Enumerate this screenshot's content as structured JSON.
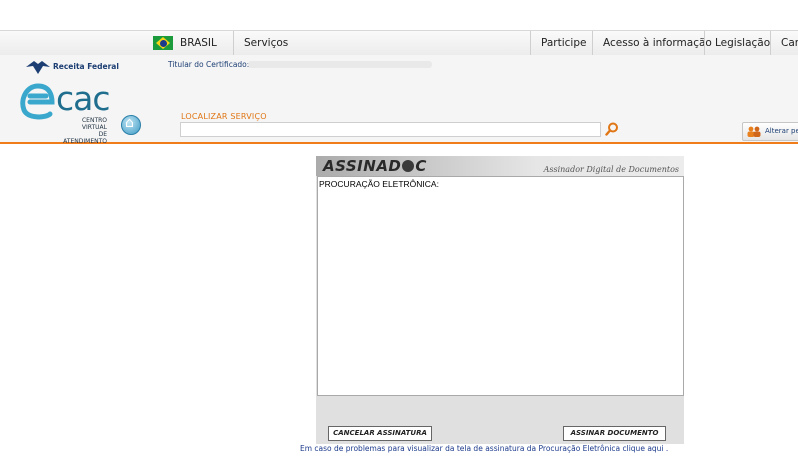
{
  "govbar": {
    "country": "BRASIL",
    "items": [
      "Serviços",
      "Participe",
      "Acesso à informação",
      "Legislação",
      "Can"
    ]
  },
  "header": {
    "agency": "Receita Federal",
    "titular_label": "Titular do Certificado:",
    "logo_word": "cac",
    "logo_sub_1": "CENTRO VIRTUAL",
    "logo_sub_2": "DE ATENDIMENTO",
    "search_label": "LOCALIZAR SERVIÇO",
    "search_value": "",
    "alterar_label": "Alterar pe"
  },
  "signer": {
    "logo_text_1": "ASSINAD",
    "logo_text_2": "C",
    "subtitle": "Assinador Digital de Documentos",
    "document_text": "PROCURAÇÃO ELETRÔNICA:",
    "cancel_label": "CANCELAR ASSINATURA",
    "sign_label": "ASSINAR DOCUMENTO"
  },
  "footer": {
    "note": "Em caso de problemas para visualizar da tela de assinatura da Procuração Eletrônica clique",
    "link": "aqui",
    "end": "."
  },
  "colors": {
    "accent": "#f07d1a",
    "brand": "#1f6e8e",
    "link": "#1c3a8c"
  },
  "icons": [
    "brazil-flag-icon",
    "receita-logo-icon",
    "ecac-e-icon",
    "home-icon",
    "search-icon",
    "people-icon",
    "gear-icon"
  ]
}
